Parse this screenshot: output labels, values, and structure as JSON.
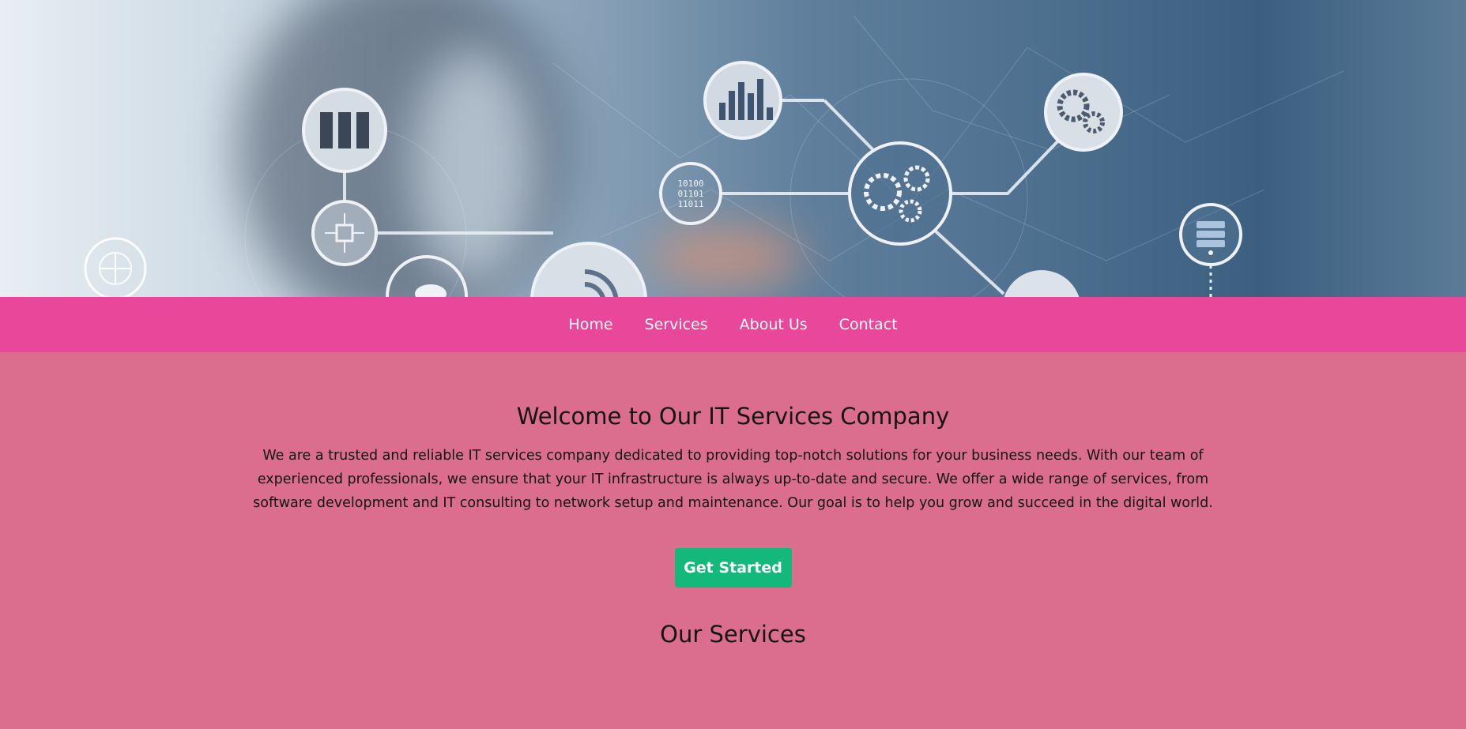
{
  "hero": {
    "image_alt": "Businessman with IT network icons",
    "icons": [
      "server-icon",
      "bar-chart-icon",
      "gears-icon",
      "binary-code-icon",
      "gear-icon",
      "chip-icon",
      "globe-icon",
      "cloud-icon",
      "wifi-icon",
      "database-icon"
    ]
  },
  "nav": {
    "items": [
      {
        "label": "Home"
      },
      {
        "label": "Services"
      },
      {
        "label": "About Us"
      },
      {
        "label": "Contact"
      }
    ]
  },
  "main": {
    "title": "Welcome to Our IT Services Company",
    "intro": "We are a trusted and reliable IT services company dedicated to providing top-notch solutions for your business needs. With our team of experienced professionals, we ensure that your IT infrastructure is always up-to-date and secure. We offer a wide range of services, from software development and IT consulting to network setup and maintenance. Our goal is to help you grow and succeed in the digital world.",
    "cta_label": "Get Started",
    "services_title": "Our Services"
  },
  "colors": {
    "nav_bg": "#e9489a",
    "page_bg": "#db6d8e",
    "cta_bg": "#13b97b"
  }
}
